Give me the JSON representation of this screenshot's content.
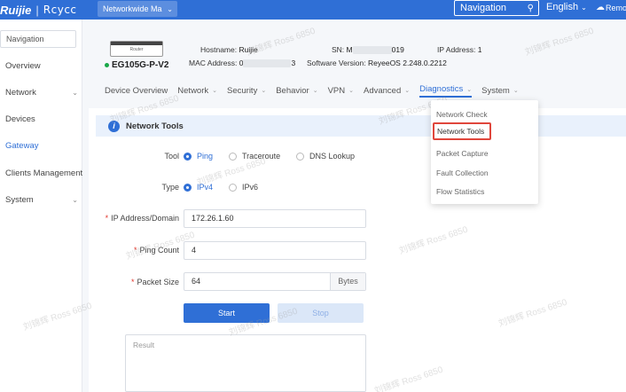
{
  "header": {
    "brand": "Ruijie",
    "brand_sep": "|",
    "product": "Rcycc",
    "network_select": "Networkwide Ma",
    "search_label": "Navigation",
    "language": "English",
    "remote": "Remot"
  },
  "sidebar": {
    "search": "Navigation",
    "items": [
      {
        "label": "Overview"
      },
      {
        "label": "Network"
      },
      {
        "label": "Devices"
      },
      {
        "label": "Gateway"
      },
      {
        "label": "Clients Management"
      },
      {
        "label": "System"
      }
    ]
  },
  "device": {
    "icon_label": "Router",
    "model": "EG105G-P-V2",
    "hostname_label": "Hostname:",
    "hostname": "Ruijie",
    "mac_label": "MAC Address:",
    "mac_start": "0",
    "mac_end": "3",
    "sn_label": "SN:",
    "sn_start": "M",
    "sn_end": "019",
    "software_label": "Software Version:",
    "software": "ReyeeOS 2.248.0.2212",
    "ip_label": "IP Address:",
    "ip": "1"
  },
  "tabs": [
    {
      "label": "Device Overview"
    },
    {
      "label": "Network"
    },
    {
      "label": "Security"
    },
    {
      "label": "Behavior"
    },
    {
      "label": "VPN"
    },
    {
      "label": "Advanced"
    },
    {
      "label": "Diagnostics"
    },
    {
      "label": "System"
    }
  ],
  "diagnostics_menu": [
    {
      "label": "Network Check"
    },
    {
      "label": "Network Tools"
    },
    {
      "label": "Packet Capture"
    },
    {
      "label": "Fault Collection"
    },
    {
      "label": "Flow Statistics"
    }
  ],
  "tool": {
    "title": "Network Tools",
    "tool_label": "Tool",
    "tool_options": [
      "Ping",
      "Traceroute",
      "DNS Lookup"
    ],
    "selected_tool": "Ping",
    "type_label": "Type",
    "type_options": [
      "IPv4",
      "IPv6"
    ],
    "selected_type": "IPv4",
    "ip_label": "IP Address/Domain",
    "ip_value": "172.26.1.60",
    "ping_count_label": "Ping Count",
    "ping_count_value": "4",
    "packet_size_label": "Packet Size",
    "packet_size_value": "64",
    "packet_size_unit": "Bytes",
    "start_label": "Start",
    "stop_label": "Stop",
    "result_placeholder": "Result"
  },
  "watermark": "刘锦辉 Ross 6850"
}
